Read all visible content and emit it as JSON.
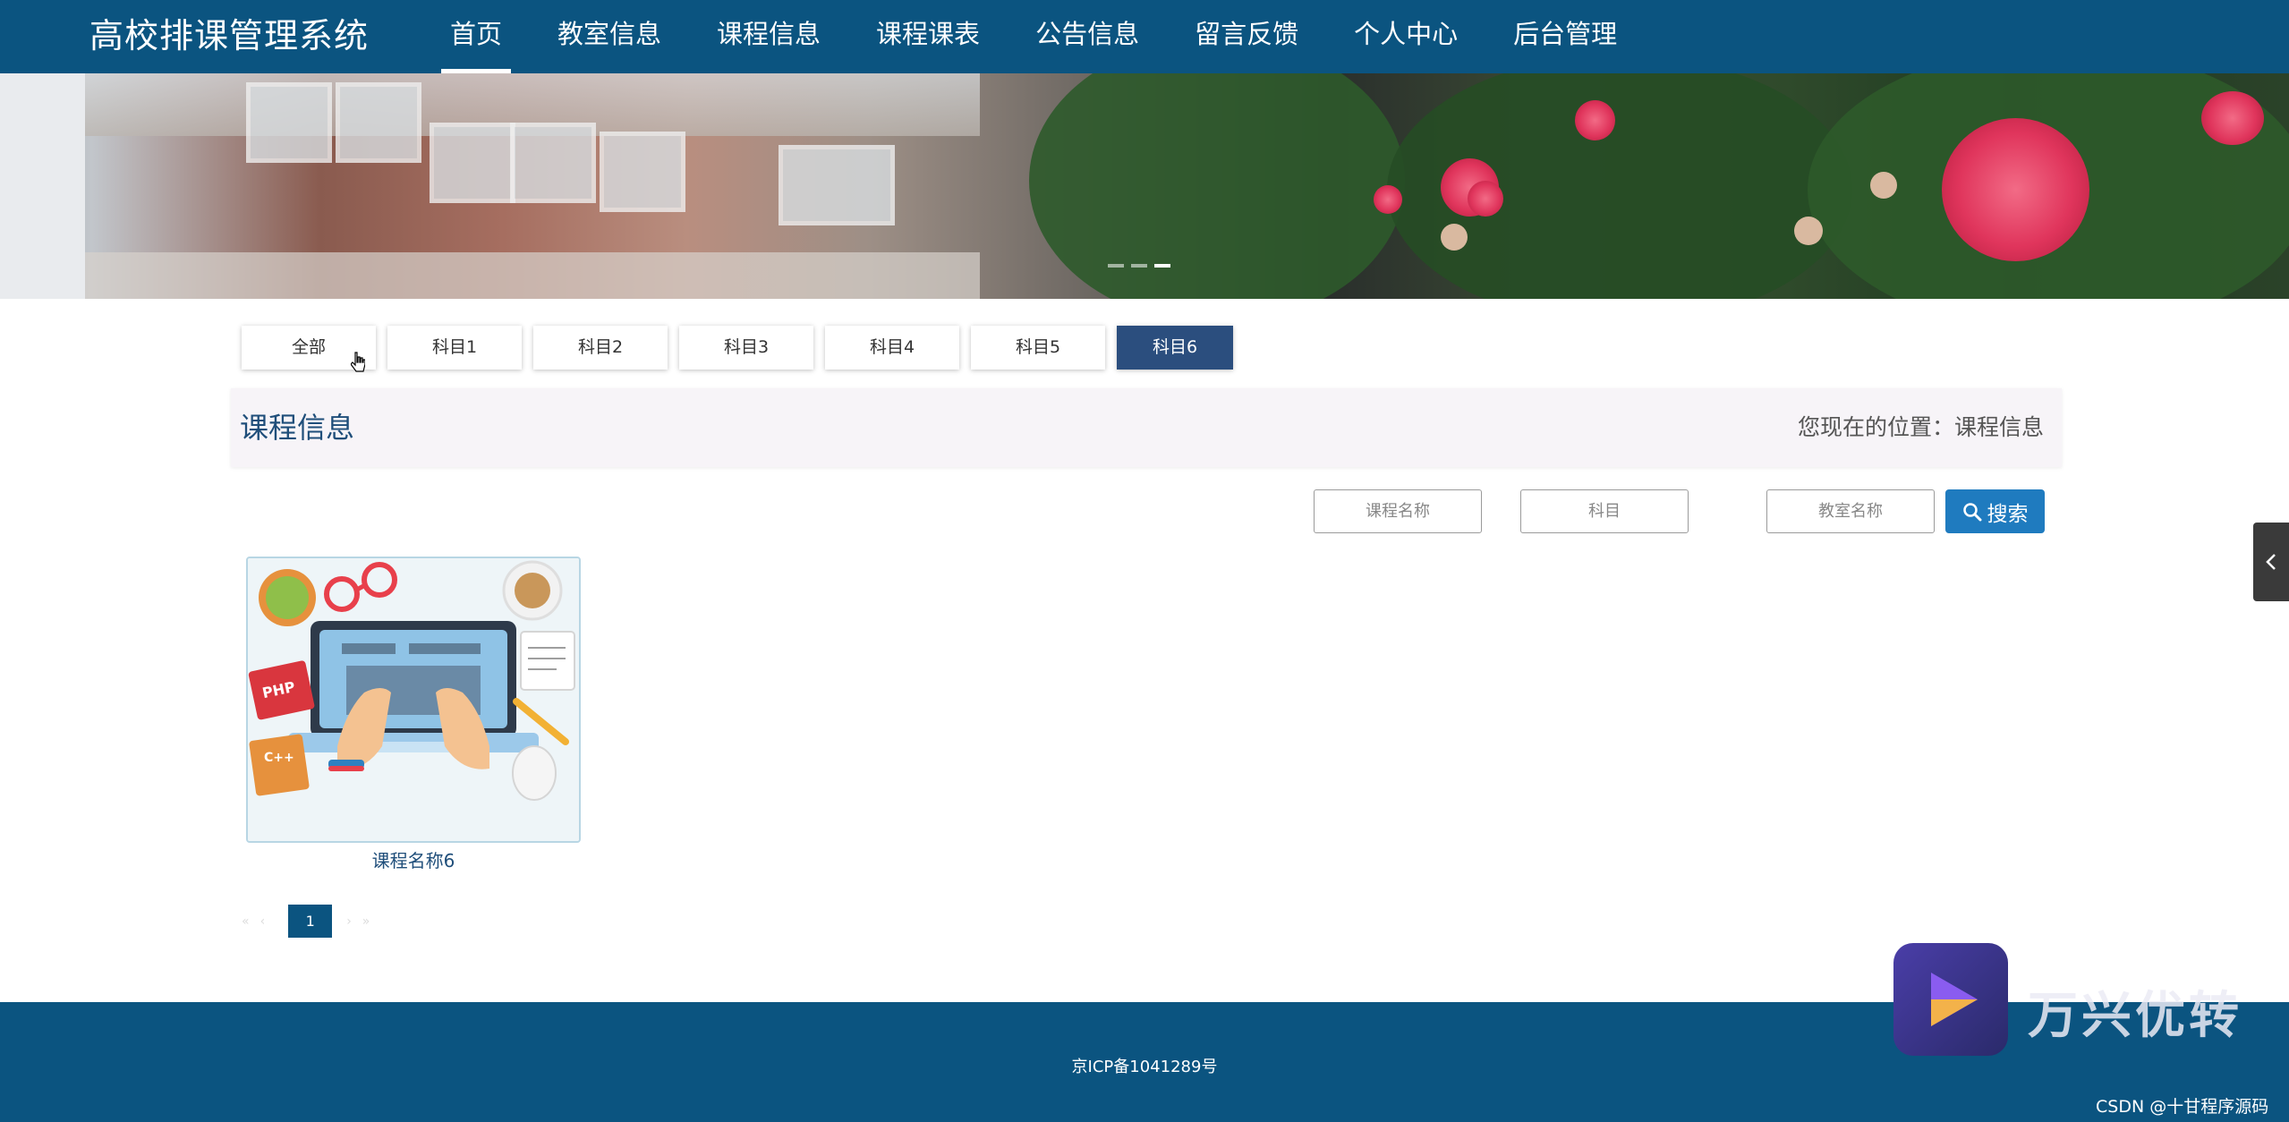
{
  "header": {
    "site_title": "高校排课管理系统",
    "nav": [
      "首页",
      "教室信息",
      "课程信息",
      "课程课表",
      "公告信息",
      "留言反馈",
      "个人中心",
      "后台管理"
    ],
    "active_nav": "首页"
  },
  "banner": {
    "slide_count": 3,
    "active_slide": 2
  },
  "categories": [
    "全部",
    "科目1",
    "科目2",
    "科目3",
    "科目4",
    "科目5",
    "科目6"
  ],
  "active_category": "科目6",
  "section": {
    "title": "课程信息",
    "location": "您现在的位置：课程信息"
  },
  "search": {
    "course_placeholder": "课程名称",
    "subject_placeholder": "科目",
    "classroom_placeholder": "教室名称",
    "button_label": "搜索"
  },
  "courses": [
    {
      "name": "课程名称6"
    }
  ],
  "pagination": {
    "current": "1"
  },
  "footer": {
    "icp": "京ICP备1041289号"
  },
  "watermark": {
    "app_text": "万兴优转",
    "csdn": "CSDN @十甘程序源码"
  },
  "colors": {
    "header_bg": "#0b5480",
    "active_tab": "#2b4e7e",
    "search_button": "#1f7bbf"
  },
  "icons": [
    "search-icon",
    "pointer-cursor-icon",
    "chevron-left-icon",
    "play-icon"
  ]
}
